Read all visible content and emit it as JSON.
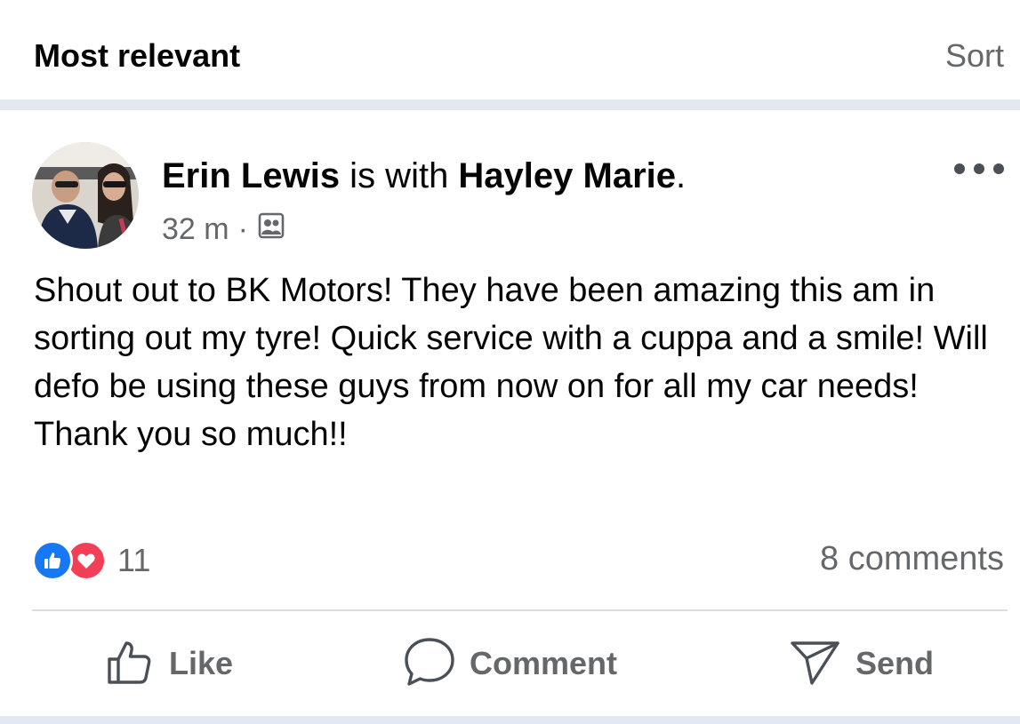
{
  "header": {
    "title": "Most relevant",
    "sort_label": "Sort"
  },
  "post": {
    "author": "Erin Lewis",
    "with_text": " is with ",
    "tagged": "Hayley Marie",
    "period": ".",
    "time": "32 m",
    "dot": "·",
    "audience_icon": "friends-icon",
    "text": "Shout out to BK Motors! They have been amazing this am in sorting out my tyre! Quick service with a cuppa and a smile! Will defo be using these guys from now on for all my car needs! Thank you so much!!",
    "reactions": {
      "types": [
        "like-reaction-icon",
        "love-reaction-icon"
      ],
      "count": "11"
    },
    "comments_count": "8 comments",
    "actions": {
      "like": "Like",
      "comment": "Comment",
      "send": "Send"
    }
  },
  "colors": {
    "accent_blue": "#1877f2",
    "love_red": "#f33e58",
    "secondary_text": "#65676b",
    "separator": "#e4e8f0"
  }
}
